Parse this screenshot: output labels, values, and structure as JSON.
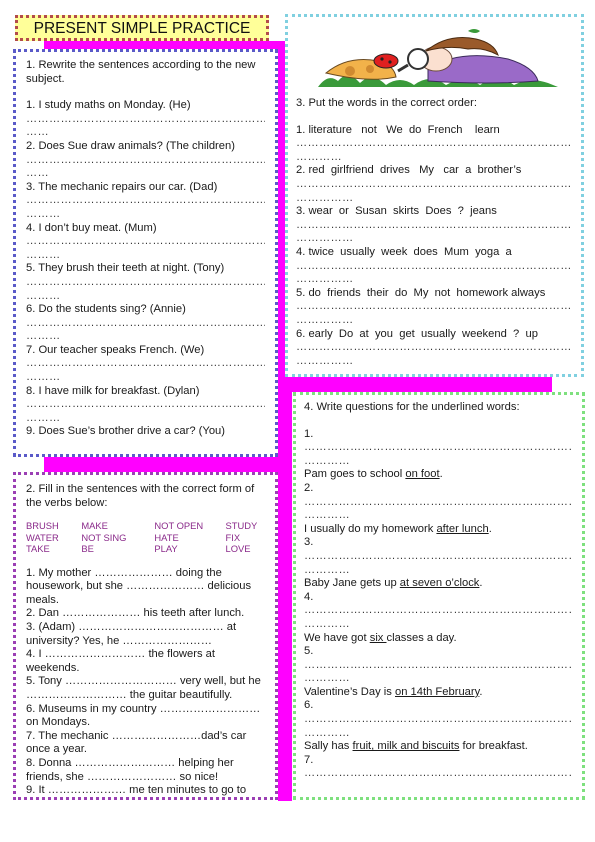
{
  "title": "PRESENT SIMPLE PRACTICE",
  "colors": {
    "accent": "#ff00ff",
    "title_bg": "#ffff99",
    "box1_border": "#5a5ac8",
    "box2_border": "#9b3fb4",
    "box3_border": "#80d0e0",
    "box4_border": "#7ee07e",
    "verb_color": "#8a2a8a"
  },
  "illustration": {
    "icon": "girl-with-magnifying-glass-and-ladybug-illustration"
  },
  "exercise1": {
    "instruction": "1. Rewrite the sentences according to the new subject.",
    "items": [
      {
        "text": "1. I study maths on Monday. (He)",
        "dots1": "………………………………………………………………",
        "dots2": "……"
      },
      {
        "text": "2. Does Sue draw animals? (The children)",
        "dots1": "………………………………………………………………",
        "dots2": "……"
      },
      {
        "text": "3. The mechanic repairs our car. (Dad)",
        "dots1": "………………………………………………………………",
        "dots2": "………"
      },
      {
        "text": "4. I don’t buy meat. (Mum)",
        "dots1": "………………………………………………………………",
        "dots2": "………"
      },
      {
        "text": "5. They brush their teeth at night. (Tony)",
        "dots1": "………………………………………………………………",
        "dots2": "………"
      },
      {
        "text": "6. Do the students sing? (Annie)",
        "dots1": "………………………………………………………………",
        "dots2": "………"
      },
      {
        "text": "7. Our teacher speaks French. (We)",
        "dots1": "………………………………………………………………",
        "dots2": "………"
      },
      {
        "text": "8. I have milk for breakfast. (Dylan)",
        "dots1": "………………………………………………………………",
        "dots2": "………"
      },
      {
        "text": "9. Does Sue’s brother drive a car? (You)"
      }
    ]
  },
  "exercise2": {
    "instruction": "2. Fill in the sentences with the correct form of the verbs below:",
    "verbs": [
      [
        "BRUSH",
        "MAKE",
        "NOT OPEN",
        "STUDY"
      ],
      [
        "WATER",
        "NOT SING",
        "HATE",
        "FIX"
      ],
      [
        "TAKE",
        "BE",
        "PLAY",
        "LOVE"
      ]
    ],
    "sentences": [
      "1. My mother ………………… doing the housework, but she ………………… delicious meals.",
      "2. Dan ………………… his teeth after lunch.",
      "3. (Adam) ………………………………… at university? Yes, he ……………………",
      "4. I ……………………… the flowers at weekends.",
      "5. Tony ………………………… very well, but he ……………………… the guitar beautifully.",
      "6. Museums in my country ……………………… on Mondays.",
      "7. The mechanic ……………………dad’s car once a year.",
      "8. Donna ……………………… helping her friends, she …………………… so nice!",
      "9. It ………………… me ten minutes to go to"
    ]
  },
  "exercise3": {
    "instruction": "3. Put the words in the correct order:",
    "items": [
      {
        "text": "1. literature   not   We  do  French    learn",
        "dots1": "…………………………………………………………………",
        "dots2": "…………"
      },
      {
        "text": "2. red  girlfriend  drives   My   car  a  brother’s",
        "dots1": "…………………………………………………………………",
        "dots2": "……………"
      },
      {
        "text": "3. wear  or  Susan  skirts  Does  ?  jeans",
        "dots1": "…………………………………………………………………",
        "dots2": "……………"
      },
      {
        "text": "4. twice  usually  week  does  Mum  yoga  a",
        "dots1": "…………………………………………………………………",
        "dots2": "……………"
      },
      {
        "text": "5. do  friends  their  do  My  not  homework always",
        "dots1": "…………………………………………………………………",
        "dots2": "……………"
      },
      {
        "text": "6. early  Do  at  you  get  usually  weekend  ?  up",
        "dots1": "…………………………………………………………………",
        "dots2": "……………"
      }
    ]
  },
  "exercise4": {
    "instruction": "4. Write questions for the underlined words:",
    "items": [
      {
        "num": "1.",
        "dots1": "…………………………………………………………………",
        "dots2": "…………",
        "pre": "Pam goes to school ",
        "underlined": "on foot",
        "post": "."
      },
      {
        "num": "2.",
        "dots1": "…………………………………………………………………",
        "dots2": "…………",
        "pre": "I usually do my homework ",
        "underlined": "after lunch",
        "post": "."
      },
      {
        "num": "3.",
        "dots1": "…………………………………………………………………",
        "dots2": "…………",
        "pre": "Baby Jane gets up ",
        "underlined": "at seven o’clock",
        "post": "."
      },
      {
        "num": "4.",
        "dots1": "…………………………………………………………………",
        "dots2": "…………",
        "pre": "We have got ",
        "underlined": "six ",
        "post": "classes a day."
      },
      {
        "num": "5.",
        "dots1": "…………………………………………………………………",
        "dots2": "…………",
        "pre": "Valentine’s Day is ",
        "underlined": "on 14th February",
        "post": "."
      },
      {
        "num": "6.",
        "dots1": "…………………………………………………………………",
        "dots2": "…………",
        "pre": "Sally has ",
        "underlined": "fruit, milk and biscuits",
        "post": " for breakfast."
      },
      {
        "num": "7.",
        "dots1": "…………………………………………………………………"
      }
    ]
  }
}
